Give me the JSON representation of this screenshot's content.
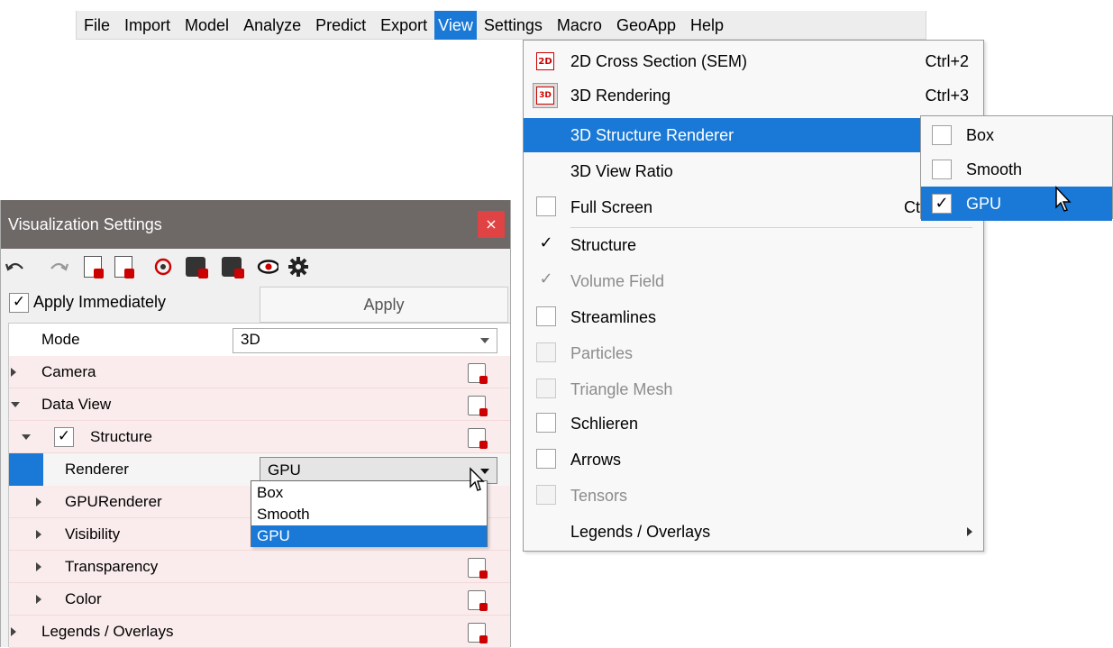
{
  "menubar": {
    "items": [
      {
        "label": "File"
      },
      {
        "label": "Import"
      },
      {
        "label": "Model"
      },
      {
        "label": "Analyze"
      },
      {
        "label": "Predict"
      },
      {
        "label": "Export"
      },
      {
        "label": "View",
        "active": true
      },
      {
        "label": "Settings"
      },
      {
        "label": "Macro"
      },
      {
        "label": "GeoApp"
      },
      {
        "label": "Help"
      }
    ]
  },
  "view_menu": {
    "item_2d": {
      "icon": "2d-cross-section-icon",
      "icon_text": "2D",
      "label": "2D Cross Section (SEM)",
      "shortcut": "Ctrl+2"
    },
    "item_3d": {
      "icon": "3d-rendering-icon",
      "icon_text": "3D",
      "label": "3D Rendering",
      "shortcut": "Ctrl+3"
    },
    "structure_renderer": {
      "label": "3D Structure Renderer"
    },
    "view_ratio": {
      "label": "3D View Ratio"
    },
    "full_screen": {
      "label": "Full Screen",
      "shortcut": "Ct"
    },
    "structure": {
      "label": "Structure",
      "check": "✓"
    },
    "volume_field": {
      "label": "Volume Field",
      "check": "✓"
    },
    "streamlines": {
      "label": "Streamlines"
    },
    "particles": {
      "label": "Particles"
    },
    "triangle_mesh": {
      "label": "Triangle Mesh"
    },
    "schlieren": {
      "label": "Schlieren"
    },
    "arrows": {
      "label": "Arrows"
    },
    "tensors": {
      "label": "Tensors"
    },
    "legends": {
      "label": "Legends / Overlays"
    }
  },
  "renderer_submenu": {
    "box": {
      "label": "Box"
    },
    "smooth": {
      "label": "Smooth"
    },
    "gpu": {
      "label": "GPU",
      "check": "✓"
    }
  },
  "vis_panel": {
    "title": "Visualization Settings",
    "close": "×",
    "apply_immediately": {
      "label": "Apply Immediately",
      "check": "✓"
    },
    "apply_button": "Apply",
    "tree": {
      "mode": {
        "label": "Mode",
        "value": "3D"
      },
      "camera": {
        "label": "Camera"
      },
      "data_view": {
        "label": "Data View"
      },
      "structure": {
        "label": "Structure",
        "check": "✓"
      },
      "renderer": {
        "label": "Renderer",
        "value": "GPU"
      },
      "gpu_renderer": {
        "label": "GPURenderer"
      },
      "visibility": {
        "label": "Visibility"
      },
      "transparency": {
        "label": "Transparency"
      },
      "color": {
        "label": "Color"
      },
      "legends": {
        "label": "Legends / Overlays"
      }
    },
    "renderer_options": [
      "Box",
      "Smooth",
      "GPU"
    ]
  },
  "colors": {
    "accent": "#1a79d6",
    "title_bar": "#6e6867",
    "close": "#e04343",
    "lock_red": "#cc0000"
  }
}
